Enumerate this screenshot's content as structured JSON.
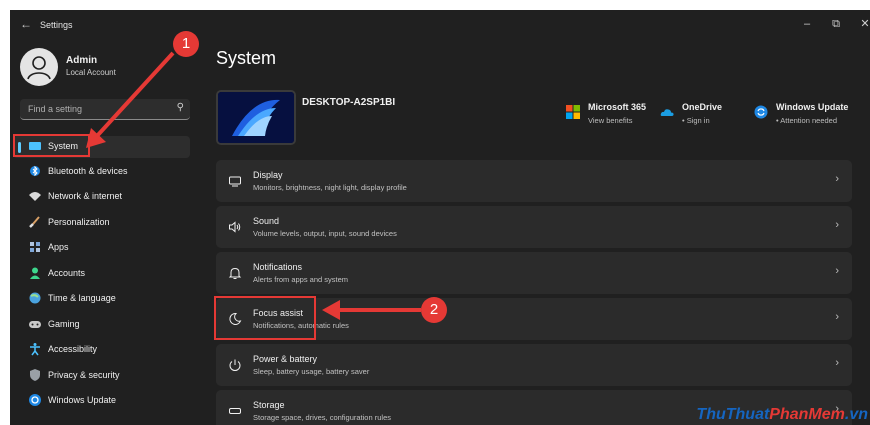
{
  "titlebar": {
    "title": "Settings",
    "minimize": "–",
    "maximize": "⧉",
    "close": "✕"
  },
  "user": {
    "name": "Admin",
    "account_type": "Local Account"
  },
  "search": {
    "placeholder": "Find a setting"
  },
  "sidebar": {
    "items": [
      {
        "label": "System",
        "icon": "monitor-icon",
        "active": true
      },
      {
        "label": "Bluetooth & devices",
        "icon": "bluetooth-icon"
      },
      {
        "label": "Network & internet",
        "icon": "wifi-icon"
      },
      {
        "label": "Personalization",
        "icon": "brush-icon"
      },
      {
        "label": "Apps",
        "icon": "apps-icon"
      },
      {
        "label": "Accounts",
        "icon": "person-icon"
      },
      {
        "label": "Time & language",
        "icon": "globe-clock-icon"
      },
      {
        "label": "Gaming",
        "icon": "controller-icon"
      },
      {
        "label": "Accessibility",
        "icon": "accessibility-icon"
      },
      {
        "label": "Privacy & security",
        "icon": "shield-icon"
      },
      {
        "label": "Windows Update",
        "icon": "update-icon"
      }
    ]
  },
  "main": {
    "title": "System",
    "device_name": "DESKTOP-A2SP1BI",
    "quick_links": [
      {
        "title": "Microsoft 365",
        "subtitle": "View benefits",
        "icon": "microsoft-logo-icon"
      },
      {
        "title": "OneDrive",
        "subtitle": "• Sign in",
        "icon": "onedrive-cloud-icon"
      },
      {
        "title": "Windows Update",
        "subtitle": "• Attention needed",
        "icon": "sync-icon"
      }
    ],
    "cards": [
      {
        "title": "Display",
        "description": "Monitors, brightness, night light, display profile",
        "icon": "display-icon"
      },
      {
        "title": "Sound",
        "description": "Volume levels, output, input, sound devices",
        "icon": "speaker-icon"
      },
      {
        "title": "Notifications",
        "description": "Alerts from apps and system",
        "icon": "bell-icon"
      },
      {
        "title": "Focus assist",
        "description": "Notifications, automatic rules",
        "icon": "moon-icon"
      },
      {
        "title": "Power & battery",
        "description": "Sleep, battery usage, battery saver",
        "icon": "power-icon"
      },
      {
        "title": "Storage",
        "description": "Storage space, drives, configuration rules",
        "icon": "storage-icon"
      }
    ]
  },
  "annotations": {
    "step1": "1",
    "step2": "2"
  },
  "watermark": {
    "part1": "ThuThuat",
    "part2": "PhanMem",
    "part3": ".vn"
  },
  "colors": {
    "accent": "#60cdff",
    "annotation": "#e53935",
    "background": "#202020",
    "card": "#2b2b2b"
  }
}
